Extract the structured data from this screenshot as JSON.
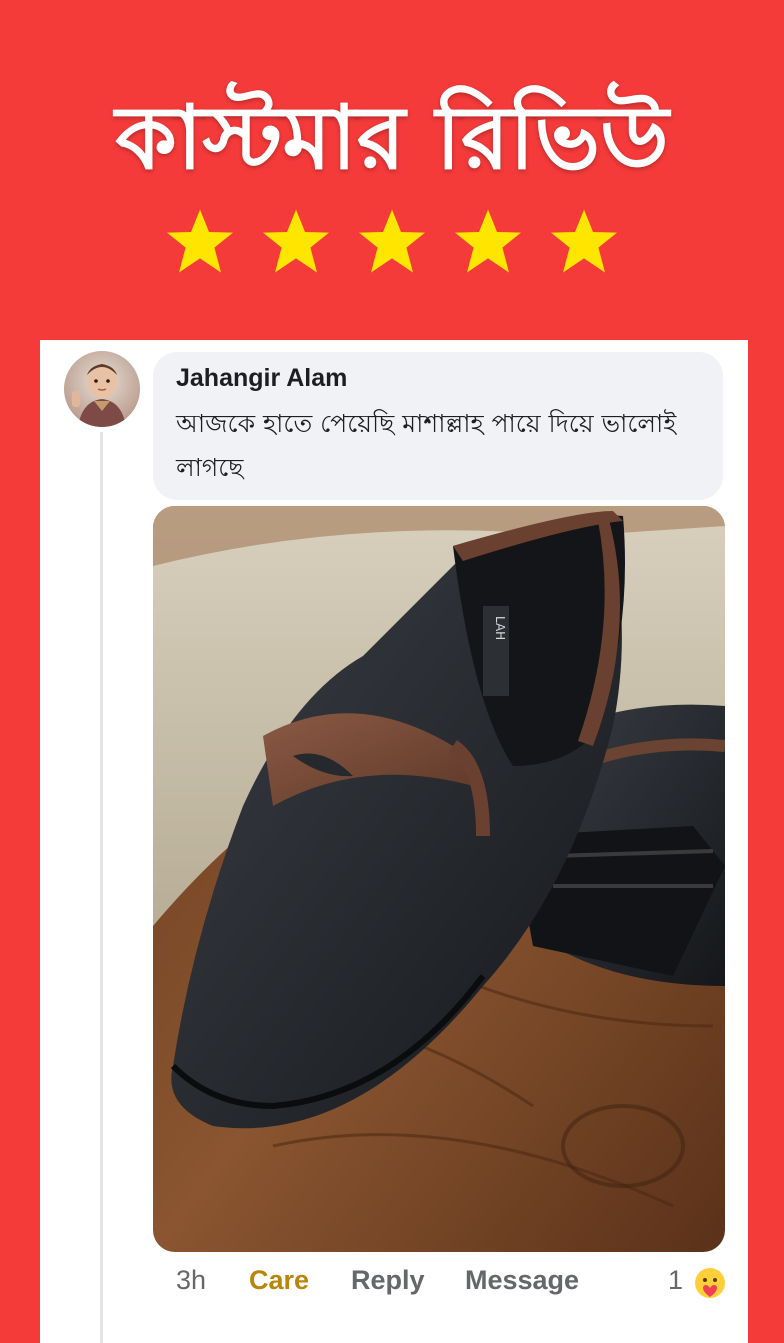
{
  "banner": {
    "title": "কাস্টমার রিভিউ",
    "rating_stars": 5,
    "star_color": "#ffe600"
  },
  "comment": {
    "author": "Jahangir Alam",
    "text": "আজকে হাতে পেয়েছি মাশাল্লাহ পায়ে দিয়ে ভালোই লাগছে",
    "photo": "penny-loafer-shoe-photo",
    "time": "3h",
    "actions": {
      "care": "Care",
      "reply": "Reply",
      "message": "Message"
    },
    "reaction_count": "1",
    "reaction_icon": "care-reaction-icon"
  },
  "colors": {
    "background": "#f53a3a",
    "card": "#ffffff",
    "bubble": "#f0f2f5",
    "care": "#b8860b"
  }
}
